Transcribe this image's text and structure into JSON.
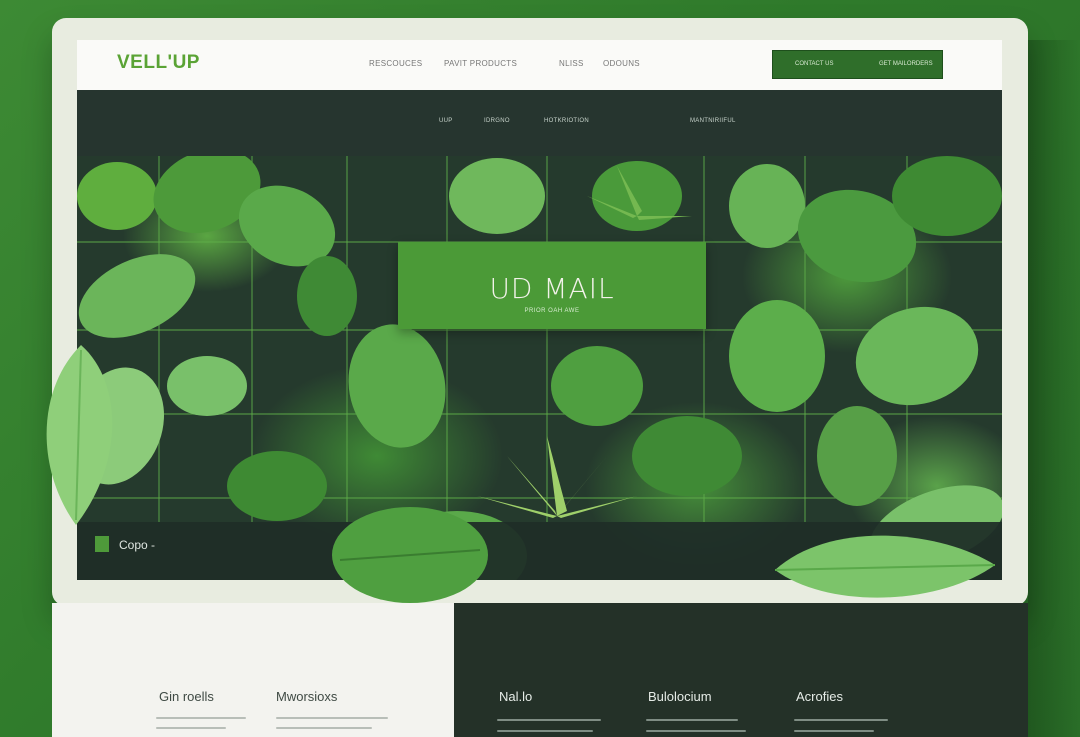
{
  "brand": {
    "logo": "VELL'UP",
    "accent": "#5aa335",
    "dark": "#26352f"
  },
  "top_nav": {
    "items": [
      "RESCOUCES",
      "PAVIT PRODUCTS",
      "NLISS",
      "ODOUNS"
    ]
  },
  "top_cta": {
    "left": "CONTACT US",
    "right": "GET MAILORDERS"
  },
  "sub_nav": {
    "items": [
      "UUP",
      "IDRGNO",
      "HOTKRIOTION",
      "MANTNIRIIFUL"
    ]
  },
  "hero": {
    "title": "UD MAIL",
    "subtitle": "PRIOR OAH AWE",
    "chip_label": "Copo -"
  },
  "footer_columns": {
    "left": [
      {
        "heading": "Gin roells"
      },
      {
        "heading": "Mworsioxs"
      }
    ],
    "right": [
      {
        "heading": "Nal.lo"
      },
      {
        "heading": "Bulolocium"
      },
      {
        "heading": "Acrofies"
      }
    ]
  }
}
